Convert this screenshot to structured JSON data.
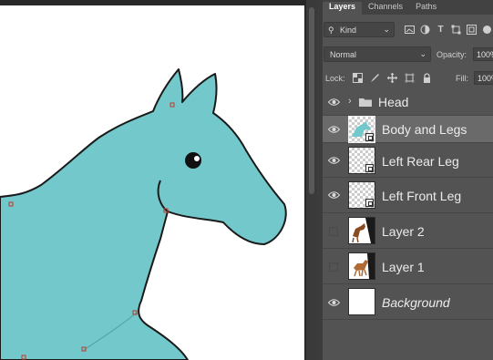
{
  "panel_tabs": [
    "Layers",
    "Channels",
    "Paths"
  ],
  "filter": {
    "kind_label": "Kind"
  },
  "blend": {
    "mode": "Normal",
    "opacity_label": "Opacity:",
    "opacity_value": "100%"
  },
  "lock": {
    "label": "Lock:",
    "fill_label": "Fill:",
    "fill_value": "100%"
  },
  "layers": [
    {
      "name": "Head",
      "type": "group",
      "visible": true,
      "italic": false,
      "selected": false
    },
    {
      "name": "Body and Legs",
      "type": "smart",
      "visible": true,
      "italic": false,
      "selected": true
    },
    {
      "name": "Left Rear Leg",
      "type": "smart",
      "visible": true,
      "italic": false,
      "selected": false
    },
    {
      "name": "Left Front Leg",
      "type": "smart",
      "visible": true,
      "italic": false,
      "selected": false
    },
    {
      "name": "Layer 2",
      "type": "raster",
      "visible": false,
      "italic": false,
      "selected": false
    },
    {
      "name": "Layer 1",
      "type": "raster",
      "visible": false,
      "italic": false,
      "selected": false
    },
    {
      "name": "Background",
      "type": "background",
      "visible": true,
      "italic": true,
      "selected": false
    }
  ],
  "colors": {
    "horse_fill": "#72c8cb",
    "panel_bg": "#535353",
    "selected_row": "#6a6a6a"
  }
}
